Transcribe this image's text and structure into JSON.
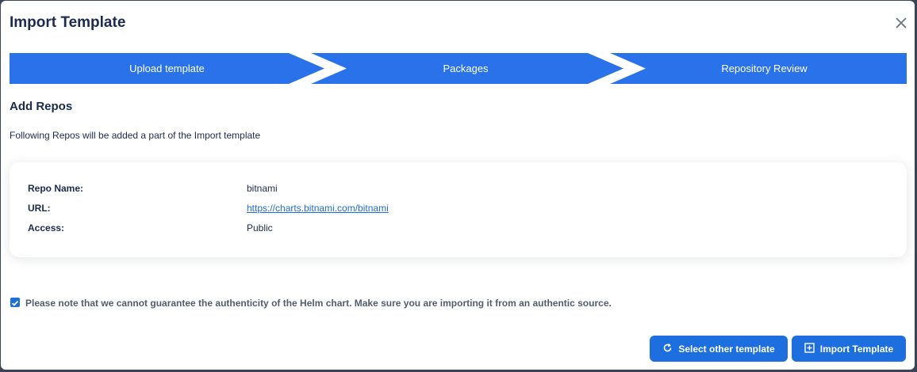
{
  "modal": {
    "title": "Import Template"
  },
  "steps": [
    {
      "label": "Upload template"
    },
    {
      "label": "Packages"
    },
    {
      "label": "Repository Review"
    }
  ],
  "section": {
    "title": "Add Repos",
    "subtitle": "Following Repos will be added a part of the Import template"
  },
  "repo": {
    "name_label": "Repo Name:",
    "name_value": "bitnami",
    "url_label": "URL:",
    "url_value": "https://charts.bitnami.com/bitnami",
    "access_label": "Access:",
    "access_value": "Public"
  },
  "notice": {
    "checked": true,
    "text": "Please note that we cannot guarantee the authenticity of the Helm chart. Make sure you are importing it from an authentic source."
  },
  "buttons": {
    "select_other": "Select other template",
    "import": "Import Template"
  },
  "colors": {
    "accent": "#1d6fe0",
    "step_bg": "#2a72ea",
    "title": "#1b2b4d"
  },
  "icons": {
    "close": "close-icon",
    "refresh": "refresh-icon",
    "import": "plus-square-icon",
    "checkbox": "checkbox-checked-icon"
  }
}
